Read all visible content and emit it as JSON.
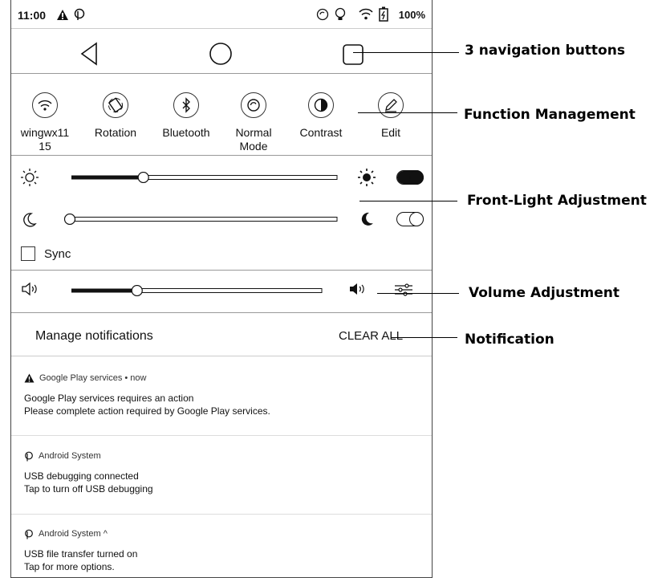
{
  "status": {
    "time": "11:00",
    "battery": "100%"
  },
  "quick_settings": [
    {
      "icon": "wifi-icon",
      "label": "wingwx11\n15"
    },
    {
      "icon": "rotation-icon",
      "label": "Rotation"
    },
    {
      "icon": "bluetooth-icon",
      "label": "Bluetooth"
    },
    {
      "icon": "refresh-mode-icon",
      "label": "Normal\nMode"
    },
    {
      "icon": "contrast-icon",
      "label": "Contrast"
    },
    {
      "icon": "edit-icon",
      "label": "Edit"
    }
  ],
  "front_light": {
    "warm_level": 0.26,
    "cold_level": 0.0,
    "warm_on": true,
    "cold_on": false
  },
  "sync": {
    "label": "Sync",
    "checked": false
  },
  "volume": {
    "level": 0.25
  },
  "notifications_header": {
    "manage_label": "Manage notifications",
    "clear_label": "CLEAR ALL"
  },
  "notifications": [
    {
      "app": "Google Play services • now",
      "title": "Google Play services requires an action",
      "text": "Please complete action required by Google Play services."
    },
    {
      "app": "Android System",
      "title": "USB debugging connected",
      "text": "Tap to turn off USB debugging"
    },
    {
      "app": "Android System ^",
      "title": "USB file transfer turned on",
      "text": "Tap for more options."
    }
  ],
  "annotations": {
    "nav": "3 navigation buttons",
    "function": "Function Management",
    "front_light": "Front-Light Adjustment",
    "volume": "Volume Adjustment",
    "notification": "Notification"
  }
}
